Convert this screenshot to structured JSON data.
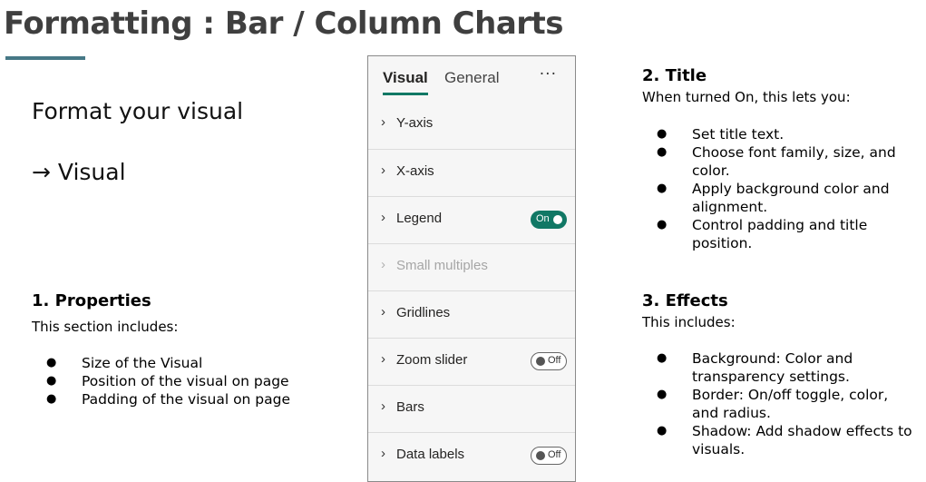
{
  "page": {
    "title": "Formatting : Bar / Column Charts"
  },
  "intro": {
    "line1": "Format your visual",
    "line2": "→ Visual"
  },
  "properties": {
    "heading": "1. Properties",
    "subtext": "This section includes:",
    "bullets": [
      "Size of the Visual",
      "Position of the visual on page",
      "Padding of the visual on page"
    ]
  },
  "title_section": {
    "heading": "2. Title",
    "subtext": "When turned On, this lets you:",
    "bullets": [
      [
        "Set title text."
      ],
      [
        "Choose font family, size, and",
        "color."
      ],
      [
        "Apply background color and",
        "alignment."
      ],
      [
        "Control padding and title",
        "position."
      ]
    ]
  },
  "effects": {
    "heading": "3. Effects",
    "subtext": "This includes:",
    "bullets": [
      [
        "Background: Color and",
        "transparency settings."
      ],
      [
        "Border: On/off toggle, color,",
        "and radius."
      ],
      [
        "Shadow: Add shadow effects to",
        "visuals."
      ]
    ]
  },
  "format_pane": {
    "tabs": [
      "Visual",
      "General"
    ],
    "active_tab": "Visual",
    "more_icon": "more-options-icon",
    "accent_color": "#117865",
    "sections": [
      {
        "label": "Y-axis"
      },
      {
        "label": "X-axis"
      },
      {
        "label": "Legend",
        "toggle": "On"
      },
      {
        "label": "Small multiples",
        "disabled": true
      },
      {
        "label": "Gridlines"
      },
      {
        "label": "Zoom slider",
        "toggle": "Off"
      },
      {
        "label": "Bars"
      },
      {
        "label": "Data labels",
        "toggle": "Off"
      }
    ]
  },
  "colors": {
    "title_text": "#3f3f3f",
    "title_underline": "#467886"
  }
}
